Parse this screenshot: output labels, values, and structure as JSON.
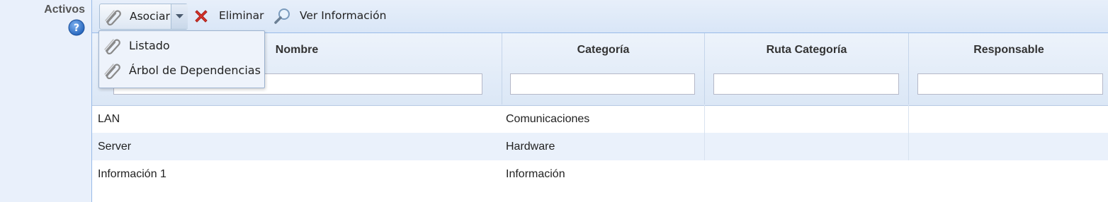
{
  "field": {
    "label": "Activos",
    "help_icon": "question-icon"
  },
  "toolbar": {
    "associate_label": "Asociar",
    "delete_label": "Eliminar",
    "view_label": "Ver Información"
  },
  "associate_menu": {
    "items": [
      {
        "label": "Listado",
        "icon": "paperclip-icon"
      },
      {
        "label": "Árbol de Dependencias",
        "icon": "paperclip-icon"
      }
    ]
  },
  "table": {
    "columns": [
      {
        "label": "Nombre",
        "filter_value": ""
      },
      {
        "label": "Categoría",
        "filter_value": ""
      },
      {
        "label": "Ruta Categoría",
        "filter_value": ""
      },
      {
        "label": "Responsable",
        "filter_value": ""
      }
    ],
    "rows": [
      {
        "nombre": "LAN",
        "categoria": "Comunicaciones",
        "ruta": "",
        "responsable": ""
      },
      {
        "nombre": "Server",
        "categoria": "Hardware",
        "ruta": "",
        "responsable": ""
      },
      {
        "nombre": "Información 1",
        "categoria": "Información",
        "ruta": "",
        "responsable": ""
      }
    ]
  },
  "colors": {
    "accent": "#99bbe8",
    "delete_red": "#d9342b",
    "help_blue": "#2a6fc4"
  }
}
